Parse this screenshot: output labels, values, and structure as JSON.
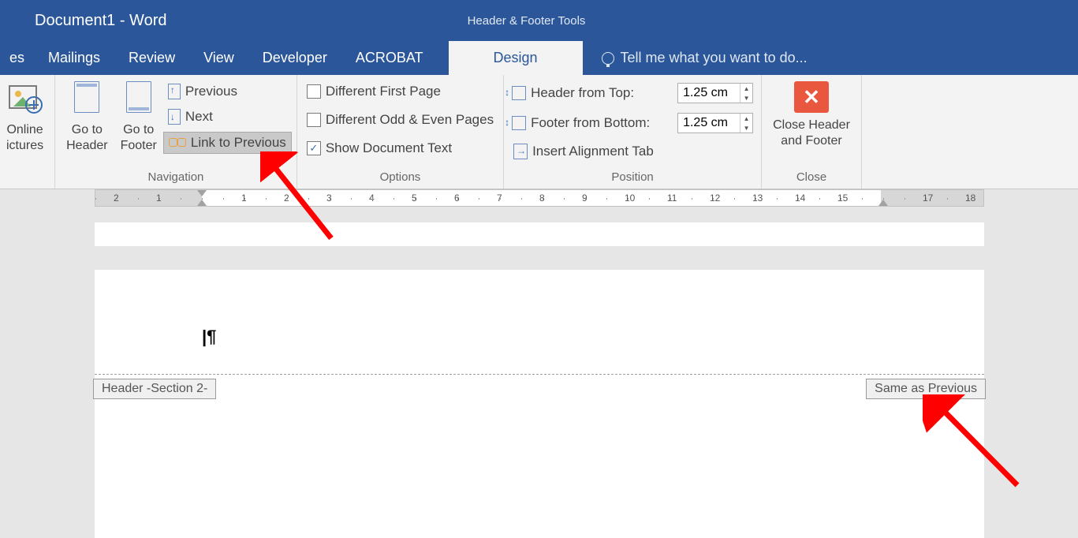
{
  "titlebar": {
    "document_title": "Document1 - Word",
    "contextual_tab_title": "Header & Footer Tools"
  },
  "tabs": {
    "partial0": "es",
    "mailings": "Mailings",
    "review": "Review",
    "view": "View",
    "developer": "Developer",
    "acrobat": "ACROBAT",
    "design": "Design",
    "tellme": "Tell me what you want to do..."
  },
  "ribbon": {
    "group0": {
      "online_pictures_l1": "Online",
      "online_pictures_l2": "ictures"
    },
    "navigation": {
      "go_to_header_l1": "Go to",
      "go_to_header_l2": "Header",
      "go_to_footer_l1": "Go to",
      "go_to_footer_l2": "Footer",
      "previous": "Previous",
      "next": "Next",
      "link_to_previous": "Link to Previous",
      "label": "Navigation"
    },
    "options": {
      "diff_first": "Different First Page",
      "diff_odd_even": "Different Odd & Even Pages",
      "show_doc_text": "Show Document Text",
      "label": "Options"
    },
    "position": {
      "header_from_top": "Header from Top:",
      "footer_from_bottom": "Footer from Bottom:",
      "insert_alignment_tab": "Insert Alignment Tab",
      "header_value": "1.25 cm",
      "footer_value": "1.25 cm",
      "label": "Position"
    },
    "close": {
      "line1": "Close Header",
      "line2": "and Footer",
      "label": "Close"
    }
  },
  "page": {
    "header_tag": "Header -Section 2-",
    "same_as_previous": "Same as Previous"
  },
  "ruler": {
    "numbers": [
      "2",
      "1",
      "1",
      "2",
      "3",
      "4",
      "5",
      "6",
      "7",
      "8",
      "9",
      "10",
      "11",
      "12",
      "13",
      "14",
      "15",
      "17",
      "18"
    ]
  }
}
